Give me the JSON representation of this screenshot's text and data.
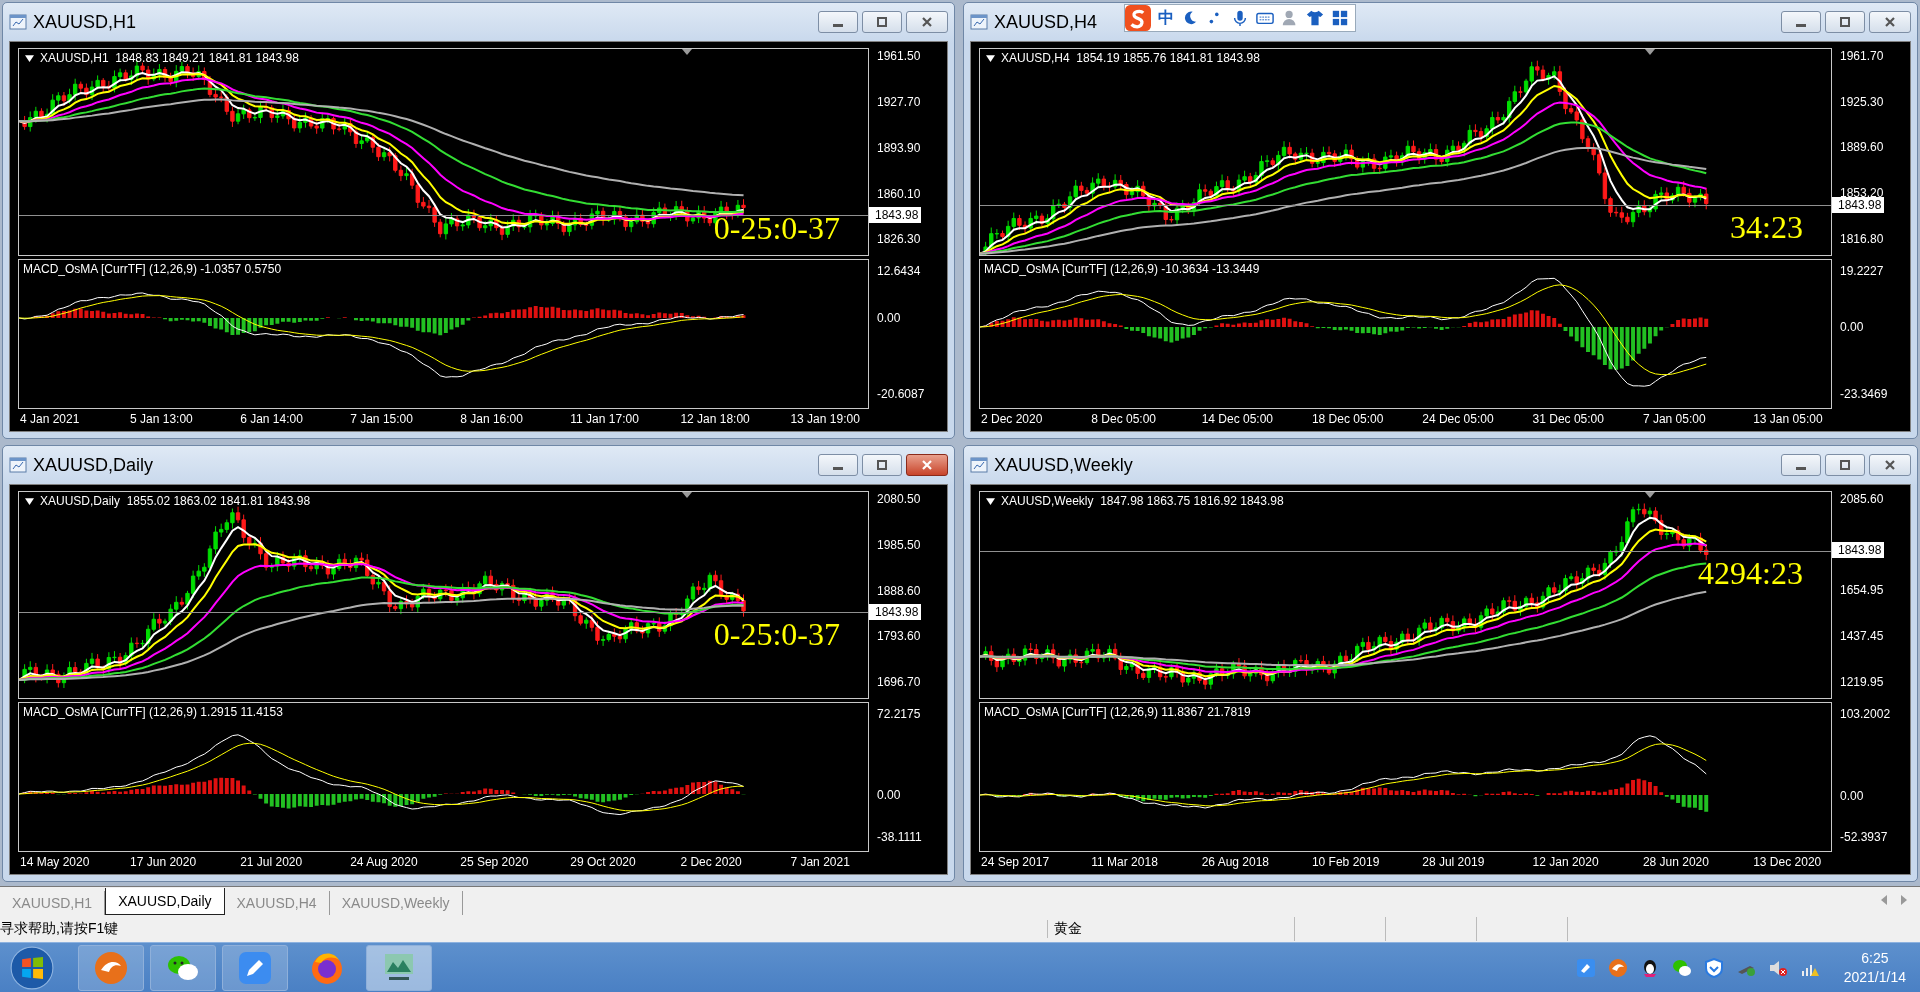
{
  "windows": [
    {
      "title": "XAUUSD,H1",
      "active": false,
      "symbol_line": "XAUUSD,H1  1848.83 1849.21 1841.81 1843.98",
      "price_ticks": [
        "1961.50",
        "1927.70",
        "1893.90",
        "1860.10",
        "1826.30"
      ],
      "current_price": "1843.98",
      "countdown": "0-25:0-37",
      "macd_line": "MACD_OsMA [CurrTF] (12,26,9) -1.0357 0.5750",
      "macd_ticks": [
        "12.6434",
        "0.00",
        "-20.6087"
      ],
      "dates": [
        "4 Jan 2021",
        "5 Jan 13:00",
        "6 Jan 14:00",
        "7 Jan 15:00",
        "8 Jan 16:00",
        "11 Jan 17:00",
        "12 Jan 18:00",
        "13 Jan 19:00"
      ]
    },
    {
      "title": "XAUUSD,H4",
      "active": false,
      "symbol_line": "XAUUSD,H4  1854.19 1855.76 1841.81 1843.98",
      "price_ticks": [
        "1961.70",
        "1925.30",
        "1889.60",
        "1853.20",
        "1816.80"
      ],
      "current_price": "1843.98",
      "countdown": "34:23",
      "macd_line": "MACD_OsMA [CurrTF] (12,26,9) -10.3634 -13.3449",
      "macd_ticks": [
        "19.2227",
        "0.00",
        "-23.3469"
      ],
      "dates": [
        "2 Dec 2020",
        "8 Dec 05:00",
        "14 Dec 05:00",
        "18 Dec 05:00",
        "24 Dec 05:00",
        "31 Dec 05:00",
        "7 Jan 05:00",
        "13 Jan 05:00"
      ]
    },
    {
      "title": "XAUUSD,Daily",
      "active": true,
      "symbol_line": "XAUUSD,Daily  1855.02 1863.02 1841.81 1843.98",
      "price_ticks": [
        "2080.50",
        "1985.50",
        "1888.60",
        "1793.60",
        "1696.70"
      ],
      "current_price": "1843.98",
      "countdown": "0-25:0-37",
      "macd_line": "MACD_OsMA [CurrTF] (12,26,9) 1.2915 11.4153",
      "macd_ticks": [
        "72.2175",
        "0.00",
        "-38.1111"
      ],
      "dates": [
        "14 May 2020",
        "17 Jun 2020",
        "21 Jul 2020",
        "24 Aug 2020",
        "25 Sep 2020",
        "29 Oct 2020",
        "2 Dec 2020",
        "7 Jan 2021"
      ]
    },
    {
      "title": "XAUUSD,Weekly",
      "active": false,
      "symbol_line": "XAUUSD,Weekly  1847.98 1863.75 1816.92 1843.98",
      "price_ticks": [
        "2085.60",
        "1654.95",
        "1437.45",
        "1219.95"
      ],
      "current_price": "1843.98",
      "countdown": "4294:23",
      "macd_line": "MACD_OsMA [CurrTF] (12,26,9) 11.8367 21.7819",
      "macd_ticks": [
        "103.2002",
        "0.00",
        "-52.3937"
      ],
      "dates": [
        "24 Sep 2017",
        "11 Mar 2018",
        "26 Aug 2018",
        "10 Feb 2019",
        "28 Jul 2019",
        "12 Jan 2020",
        "28 Jun 2020",
        "13 Dec 2020"
      ]
    }
  ],
  "ime_toolbar": {
    "mode": "中"
  },
  "tabs": [
    {
      "label": "XAUUSD,H1",
      "selected": false
    },
    {
      "label": "XAUUSD,Daily",
      "selected": true
    },
    {
      "label": "XAUUSD,H4",
      "selected": false
    },
    {
      "label": "XAUUSD,Weekly",
      "selected": false
    }
  ],
  "status_bar": {
    "help": "寻求帮助,请按F1键",
    "symbol": "黄金"
  },
  "taskbar": {
    "time": "6:25",
    "date": "2021/1/14"
  }
}
